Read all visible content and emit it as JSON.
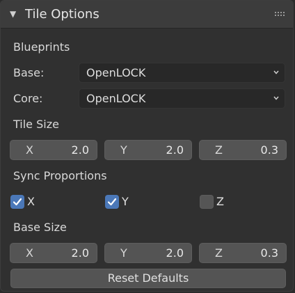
{
  "panel": {
    "title": "Tile Options",
    "collapse_icon": "triangle-down-icon",
    "drag_icon": "drag-handle-icon"
  },
  "blueprints": {
    "heading": "Blueprints",
    "base_label": "Base:",
    "base_value": "OpenLOCK",
    "core_label": "Core:",
    "core_value": "OpenLOCK"
  },
  "tile_size": {
    "heading": "Tile Size",
    "x_label": "X",
    "x_value": "2.0",
    "y_label": "Y",
    "y_value": "2.0",
    "z_label": "Z",
    "z_value": "0.3"
  },
  "sync": {
    "heading": "Sync Proportions",
    "x_label": "X",
    "x_checked": true,
    "y_label": "Y",
    "y_checked": true,
    "z_label": "Z",
    "z_checked": false
  },
  "base_size": {
    "heading": "Base Size",
    "x_label": "X",
    "x_value": "2.0",
    "y_label": "Y",
    "y_value": "2.0",
    "z_label": "Z",
    "z_value": "0.3"
  },
  "reset_label": "Reset Defaults",
  "colors": {
    "accent": "#4b78b8",
    "panel_bg": "#303030",
    "field_bg": "#545454"
  }
}
